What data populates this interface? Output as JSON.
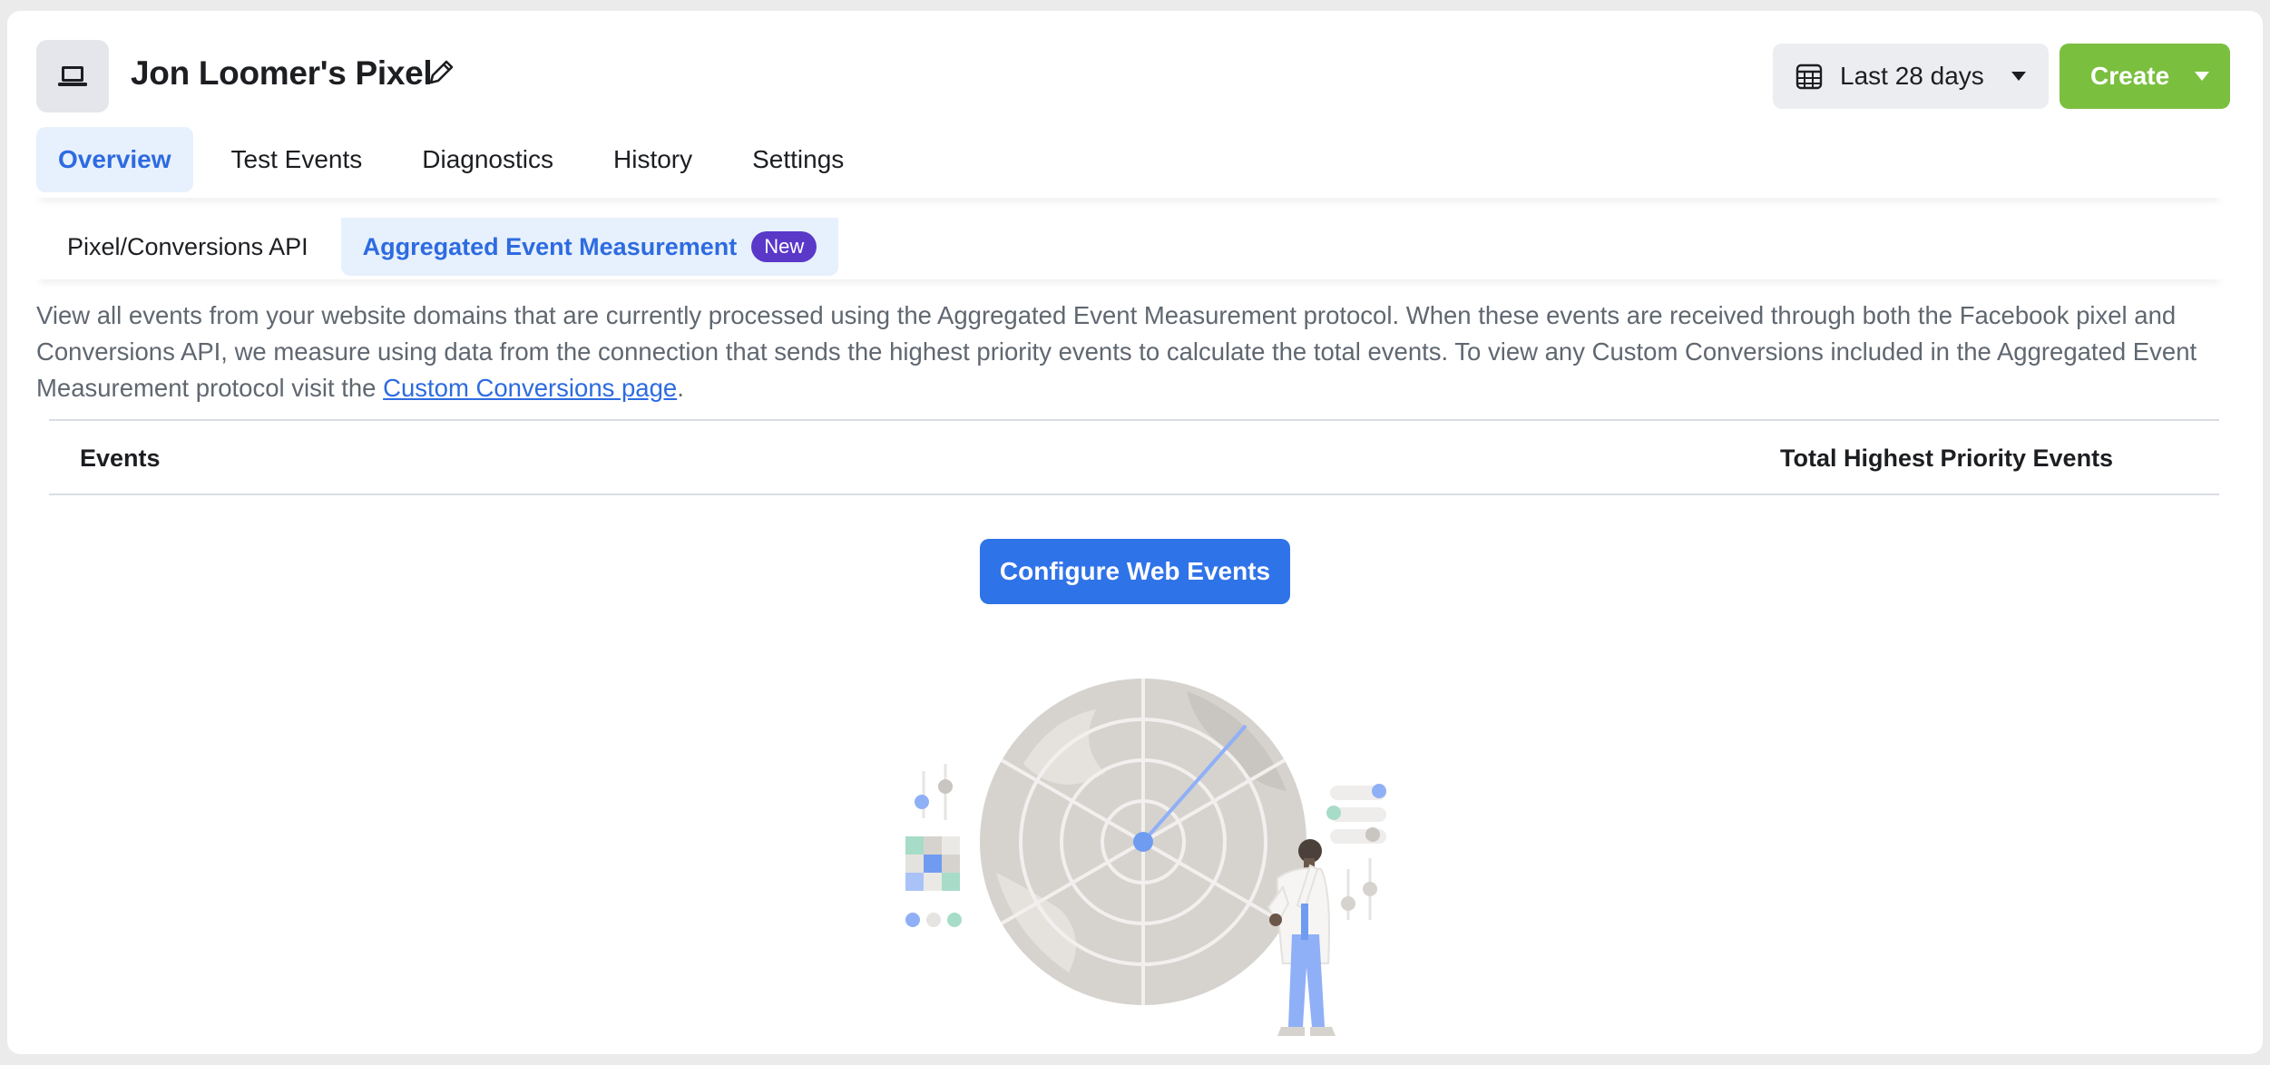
{
  "header": {
    "pixel_name": "Jon Loomer's Pixel",
    "date_range": "Last 28 days",
    "create_label": "Create"
  },
  "tabs": [
    {
      "label": "Overview",
      "active": true
    },
    {
      "label": "Test Events",
      "active": false
    },
    {
      "label": "Diagnostics",
      "active": false
    },
    {
      "label": "History",
      "active": false
    },
    {
      "label": "Settings",
      "active": false
    }
  ],
  "subtabs": [
    {
      "label": "Pixel/Conversions API",
      "active": false
    },
    {
      "label": "Aggregated Event Measurement",
      "active": true,
      "badge": "New"
    }
  ],
  "description": {
    "text": "View all events from your website domains that are currently processed using the Aggregated Event Measurement protocol. When these events are received through both the Facebook pixel and Conversions API, we measure using data from the connection that sends the highest priority events to calculate the total events. To view any Custom Conversions included in the Aggregated Event Measurement protocol visit the ",
    "link": "Custom Conversions page",
    "suffix": "."
  },
  "table": {
    "columns": [
      "Events",
      "Total Highest Priority Events"
    ]
  },
  "configure_button": "Configure Web Events",
  "colors": {
    "accent": "#2d6be0",
    "create_green": "#7bbf3f",
    "badge_purple": "#5a38c8",
    "primary_blue": "#2f73e8"
  }
}
